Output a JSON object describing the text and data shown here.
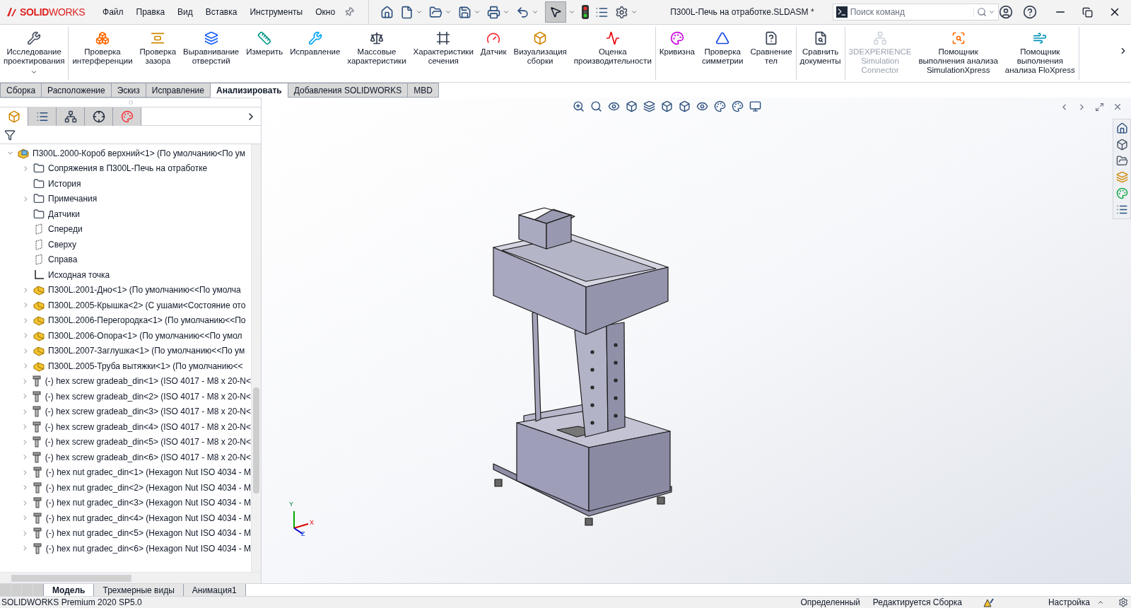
{
  "app": {
    "logo": "**SOLID**WORKS",
    "menu": [
      "Файл",
      "Правка",
      "Вид",
      "Вставка",
      "Инструменты",
      "Окно"
    ],
    "title": "П300L-Печь на отработке.SLDASM *",
    "search": {
      "placeholder": "Поиск команд"
    }
  },
  "ribbon": {
    "groups": [
      [
        {
          "label": "Исследование\nпроектирования",
          "disabled": false,
          "dropdown": true
        }
      ],
      [
        {
          "label": "Проверка\nинтерференции",
          "disabled": false
        },
        {
          "label": "Проверка\nзазора",
          "disabled": false
        },
        {
          "label": "Выравнивание\nотверстий",
          "disabled": false
        },
        {
          "label": "Измерить",
          "disabled": false
        },
        {
          "label": "Исправление",
          "disabled": false
        },
        {
          "label": "Массовые\nхарактеристики",
          "disabled": false
        },
        {
          "label": "Характеристики\nсечения",
          "disabled": false
        },
        {
          "label": "Датчик",
          "disabled": false
        },
        {
          "label": "Визуализация\nсборки",
          "disabled": false
        },
        {
          "label": "Оценка\nпроизводительности",
          "disabled": false
        }
      ],
      [
        {
          "label": "Кривизна",
          "disabled": false
        },
        {
          "label": "Проверка\nсимметрии",
          "disabled": false
        },
        {
          "label": "Сравнение\nтел",
          "disabled": false
        }
      ],
      [
        {
          "label": "Сравнить\nдокументы",
          "disabled": false
        }
      ],
      [
        {
          "label": "3DEXPERIENCE\nSimulation\nConnector",
          "disabled": true
        },
        {
          "label": "Помощник\nвыполнения анализа\nSimulationXpress",
          "disabled": false
        },
        {
          "label": "Помощник\nвыполнения\nанализа FloXpress",
          "disabled": false
        }
      ]
    ]
  },
  "command_tabs": [
    {
      "label": "Сборка",
      "selected": false
    },
    {
      "label": "Расположение",
      "selected": false
    },
    {
      "label": "Эскиз",
      "selected": false
    },
    {
      "label": "Исправление",
      "selected": false
    },
    {
      "label": "Анализировать",
      "selected": true
    },
    {
      "label": "Добавления SOLIDWORKS",
      "selected": false
    },
    {
      "label": "MBD",
      "selected": false
    }
  ],
  "panel_tabs": [
    {
      "selected": true
    },
    {
      "selected": false
    },
    {
      "selected": false
    },
    {
      "selected": false
    },
    {
      "selected": false
    }
  ],
  "tree": [
    {
      "label": "П300L.2000-Короб верхний<1> (По умолчанию<По ум",
      "kind": "assembly",
      "expanded": true,
      "children": [
        {
          "label": "Сопряжения в П300L-Печь на отработке",
          "kind": "mates",
          "expanded": false
        },
        {
          "label": "История",
          "kind": "history"
        },
        {
          "label": "Примечания",
          "kind": "notes",
          "expanded": false
        },
        {
          "label": "Датчики",
          "kind": "sensors"
        },
        {
          "label": "Спереди",
          "kind": "plane"
        },
        {
          "label": "Сверху",
          "kind": "plane"
        },
        {
          "label": "Справа",
          "kind": "plane"
        },
        {
          "label": "Исходная точка",
          "kind": "origin"
        },
        {
          "label": "П300L.2001-Дно<1> (По умолчанию<<По умолча",
          "kind": "part",
          "expanded": false
        },
        {
          "label": "П300L.2005-Крышка<2> (С ушами<Состояние ото",
          "kind": "part",
          "expanded": false
        },
        {
          "label": "П300L.2006-Перегородка<1> (По умолчанию<<По",
          "kind": "part",
          "expanded": false
        },
        {
          "label": "П300L.2006-Опора<1> (По умолчанию<<По умол",
          "kind": "part",
          "expanded": false
        },
        {
          "label": "П300L.2007-Заглушка<1> (По умолчанию<<По ум",
          "kind": "part",
          "expanded": false
        },
        {
          "label": "П300L.2005-Труба вытяжки<1> (По умолчанию<<",
          "kind": "part",
          "expanded": false
        },
        {
          "label": "(-) hex screw gradeab_din<1> (ISO 4017 - M8 x 20-N<",
          "kind": "fastener",
          "expanded": false
        },
        {
          "label": "(-) hex screw gradeab_din<2> (ISO 4017 - M8 x 20-N<",
          "kind": "fastener",
          "expanded": false
        },
        {
          "label": "(-) hex screw gradeab_din<3> (ISO 4017 - M8 x 20-N<",
          "kind": "fastener",
          "expanded": false
        },
        {
          "label": "(-) hex screw gradeab_din<4> (ISO 4017 - M8 x 20-N<",
          "kind": "fastener",
          "expanded": false
        },
        {
          "label": "(-) hex screw gradeab_din<5> (ISO 4017 - M8 x 20-N<",
          "kind": "fastener",
          "expanded": false
        },
        {
          "label": "(-) hex screw gradeab_din<6> (ISO 4017 - M8 x 20-N<",
          "kind": "fastener",
          "expanded": false
        },
        {
          "label": "(-) hex nut gradec_din<1> (Hexagon Nut ISO 4034 - M",
          "kind": "fastener",
          "expanded": false
        },
        {
          "label": "(-) hex nut gradec_din<2> (Hexagon Nut ISO 4034 - M",
          "kind": "fastener",
          "expanded": false
        },
        {
          "label": "(-) hex nut gradec_din<3> (Hexagon Nut ISO 4034 - M",
          "kind": "fastener",
          "expanded": false
        },
        {
          "label": "(-) hex nut gradec_din<4> (Hexagon Nut ISO 4034 - M",
          "kind": "fastener",
          "expanded": false
        },
        {
          "label": "(-) hex nut gradec_din<5> (Hexagon Nut ISO 4034 - M",
          "kind": "fastener",
          "expanded": false
        },
        {
          "label": "(-) hex nut gradec_din<6> (Hexagon Nut ISO 4034 - M",
          "kind": "fastener",
          "expanded": false
        }
      ]
    }
  ],
  "triad": {
    "x": "X",
    "y": "Y",
    "z": "Z"
  },
  "bottom_tabs": [
    {
      "label": "Модель",
      "selected": true
    },
    {
      "label": "Трехмерные виды",
      "selected": false
    },
    {
      "label": "Анимация1",
      "selected": false
    }
  ],
  "status_bar": {
    "version": "SOLIDWORKS Premium 2020 SP5.0",
    "state": "Определенный",
    "mode": "Редактируется Сборка",
    "units": "Настройка"
  }
}
